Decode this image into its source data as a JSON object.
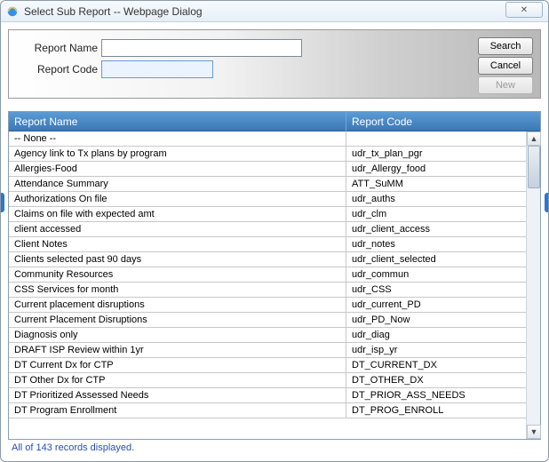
{
  "window": {
    "title": "Select Sub Report -- Webpage Dialog",
    "close_glyph": "✕"
  },
  "search": {
    "labels": {
      "name": "Report Name",
      "code": "Report Code"
    },
    "values": {
      "name": "",
      "code": ""
    },
    "buttons": {
      "search": "Search",
      "cancel": "Cancel",
      "new": "New"
    }
  },
  "columns": {
    "name": "Report Name",
    "code": "Report Code"
  },
  "rows": [
    {
      "name": "-- None --",
      "code": ""
    },
    {
      "name": "Agency link to Tx plans by program",
      "code": "udr_tx_plan_pgr"
    },
    {
      "name": "Allergies-Food",
      "code": "udr_Allergy_food"
    },
    {
      "name": "Attendance Summary",
      "code": "ATT_SuMM"
    },
    {
      "name": "Authorizations On file",
      "code": "udr_auths"
    },
    {
      "name": "Claims on file with expected amt",
      "code": "udr_clm"
    },
    {
      "name": "client accessed",
      "code": "udr_client_access"
    },
    {
      "name": "Client Notes",
      "code": "udr_notes"
    },
    {
      "name": "Clients selected past 90 days",
      "code": "udr_client_selected"
    },
    {
      "name": "Community Resources",
      "code": "udr_commun"
    },
    {
      "name": "CSS Services for month",
      "code": "udr_CSS"
    },
    {
      "name": "Current placement disruptions",
      "code": "udr_current_PD"
    },
    {
      "name": "Current Placement Disruptions",
      "code": "udr_PD_Now"
    },
    {
      "name": "Diagnosis only",
      "code": "udr_diag"
    },
    {
      "name": "DRAFT ISP Review within 1yr",
      "code": "udr_isp_yr"
    },
    {
      "name": "DT Current Dx for CTP",
      "code": "DT_CURRENT_DX"
    },
    {
      "name": "DT Other Dx for CTP",
      "code": "DT_OTHER_DX"
    },
    {
      "name": "DT Prioritized Assessed Needs",
      "code": "DT_PRIOR_ASS_NEEDS"
    },
    {
      "name": "DT Program Enrollment",
      "code": "DT_PROG_ENROLL"
    }
  ],
  "status": "All of 143 records displayed."
}
